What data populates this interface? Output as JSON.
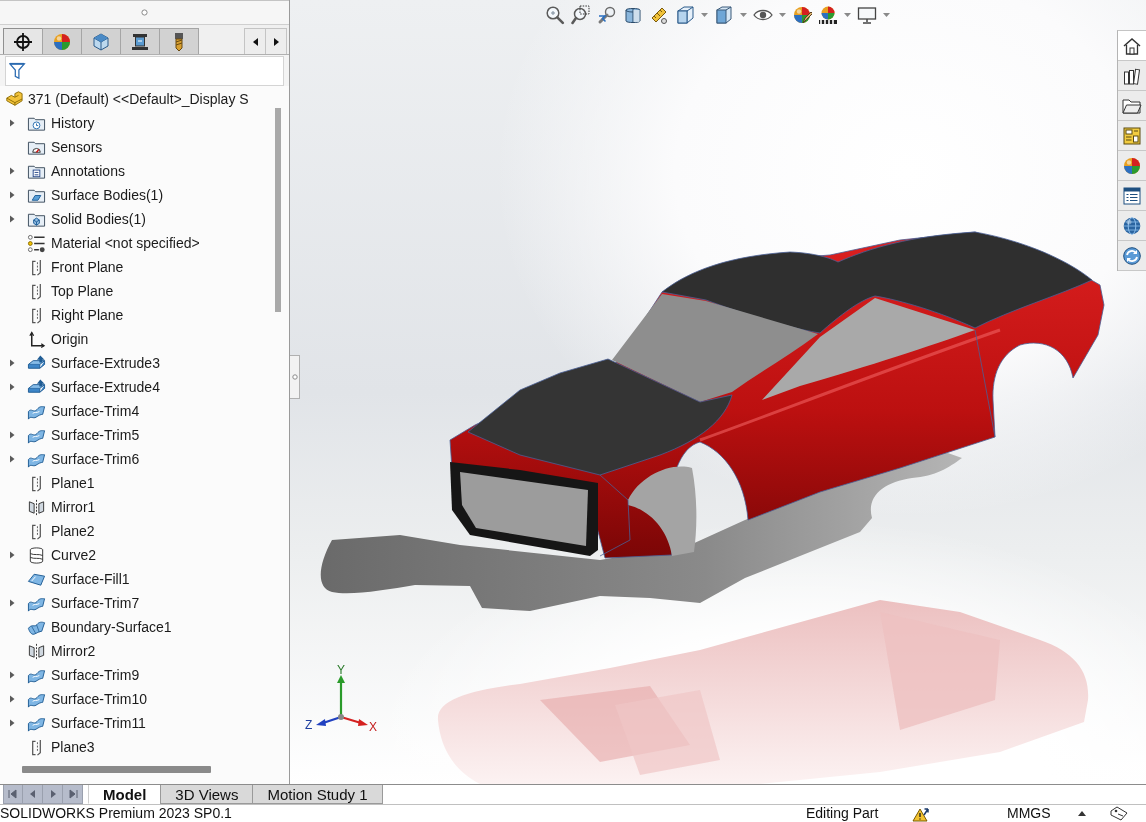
{
  "feature_panel": {
    "tabs": [
      {
        "kind": "feature",
        "selected": true
      },
      {
        "kind": "display",
        "selected": false
      },
      {
        "kind": "configuration",
        "selected": false
      },
      {
        "kind": "dimxpert",
        "selected": false
      },
      {
        "kind": "cam",
        "selected": false
      }
    ],
    "tree": {
      "label": "371 (Default) <<Default>_Display S",
      "kind": "part",
      "children": [
        {
          "label": "History",
          "kind": "history",
          "expandable": true
        },
        {
          "label": "Sensors",
          "kind": "sensors",
          "expandable": false
        },
        {
          "label": "Annotations",
          "kind": "annotations",
          "expandable": true
        },
        {
          "label": "Surface Bodies(1)",
          "kind": "surfaces",
          "expandable": true
        },
        {
          "label": "Solid Bodies(1)",
          "kind": "solids",
          "expandable": true
        },
        {
          "label": "Material <not specified>",
          "kind": "material",
          "expandable": false
        },
        {
          "label": "Front Plane",
          "kind": "plane",
          "expandable": false
        },
        {
          "label": "Top Plane",
          "kind": "plane",
          "expandable": false
        },
        {
          "label": "Right Plane",
          "kind": "plane",
          "expandable": false
        },
        {
          "label": "Origin",
          "kind": "origin",
          "expandable": false
        },
        {
          "label": "Surface-Extrude3",
          "kind": "extrude",
          "expandable": true
        },
        {
          "label": "Surface-Extrude4",
          "kind": "extrude",
          "expandable": true
        },
        {
          "label": "Surface-Trim4",
          "kind": "trim",
          "expandable": false
        },
        {
          "label": "Surface-Trim5",
          "kind": "trim",
          "expandable": true
        },
        {
          "label": "Surface-Trim6",
          "kind": "trim",
          "expandable": true
        },
        {
          "label": "Plane1",
          "kind": "plane",
          "expandable": false
        },
        {
          "label": "Mirror1",
          "kind": "mirror",
          "expandable": false
        },
        {
          "label": "Plane2",
          "kind": "plane",
          "expandable": false
        },
        {
          "label": "Curve2",
          "kind": "curve",
          "expandable": true
        },
        {
          "label": "Surface-Fill1",
          "kind": "fill",
          "expandable": false
        },
        {
          "label": "Surface-Trim7",
          "kind": "trim",
          "expandable": true
        },
        {
          "label": "Boundary-Surface1",
          "kind": "boundary",
          "expandable": false
        },
        {
          "label": "Mirror2",
          "kind": "mirror",
          "expandable": false
        },
        {
          "label": "Surface-Trim9",
          "kind": "trim",
          "expandable": true
        },
        {
          "label": "Surface-Trim10",
          "kind": "trim",
          "expandable": true
        },
        {
          "label": "Surface-Trim11",
          "kind": "trim",
          "expandable": true
        },
        {
          "label": "Plane3",
          "kind": "plane",
          "expandable": false
        }
      ]
    }
  },
  "graphics": {
    "heads_up_toolbar": [
      {
        "kind": "zoom",
        "dropdown": false
      },
      {
        "kind": "area",
        "dropdown": false
      },
      {
        "kind": "previous",
        "dropdown": false
      },
      {
        "kind": "section",
        "dropdown": false
      },
      {
        "kind": "annotation",
        "dropdown": false
      },
      {
        "kind": "orientation",
        "dropdown": true
      },
      {
        "kind": "display",
        "dropdown": true
      },
      {
        "kind": "visibility",
        "dropdown": true
      },
      {
        "kind": "appearance",
        "dropdown": false
      },
      {
        "kind": "scene",
        "dropdown": true
      },
      {
        "kind": "settings",
        "dropdown": true
      }
    ],
    "task_pane": [
      {
        "kind": "home",
        "selected": true
      },
      {
        "kind": "library",
        "selected": false
      },
      {
        "kind": "folder",
        "selected": false
      },
      {
        "kind": "palette",
        "selected": false
      },
      {
        "kind": "appearances",
        "selected": false
      },
      {
        "kind": "properties",
        "selected": false
      },
      {
        "kind": "globe",
        "selected": false
      },
      {
        "kind": "refresh",
        "selected": false
      }
    ],
    "triad": {
      "x": "X",
      "y": "Y",
      "z": "Z"
    }
  },
  "model_tabs": [
    {
      "label": "Model",
      "selected": true
    },
    {
      "label": "3D Views",
      "selected": false
    },
    {
      "label": "Motion Study 1",
      "selected": false
    }
  ],
  "status_bar": {
    "product": "SOLIDWORKS Premium 2023 SP0.1",
    "mode": "Editing Part",
    "units": "MMGS"
  }
}
